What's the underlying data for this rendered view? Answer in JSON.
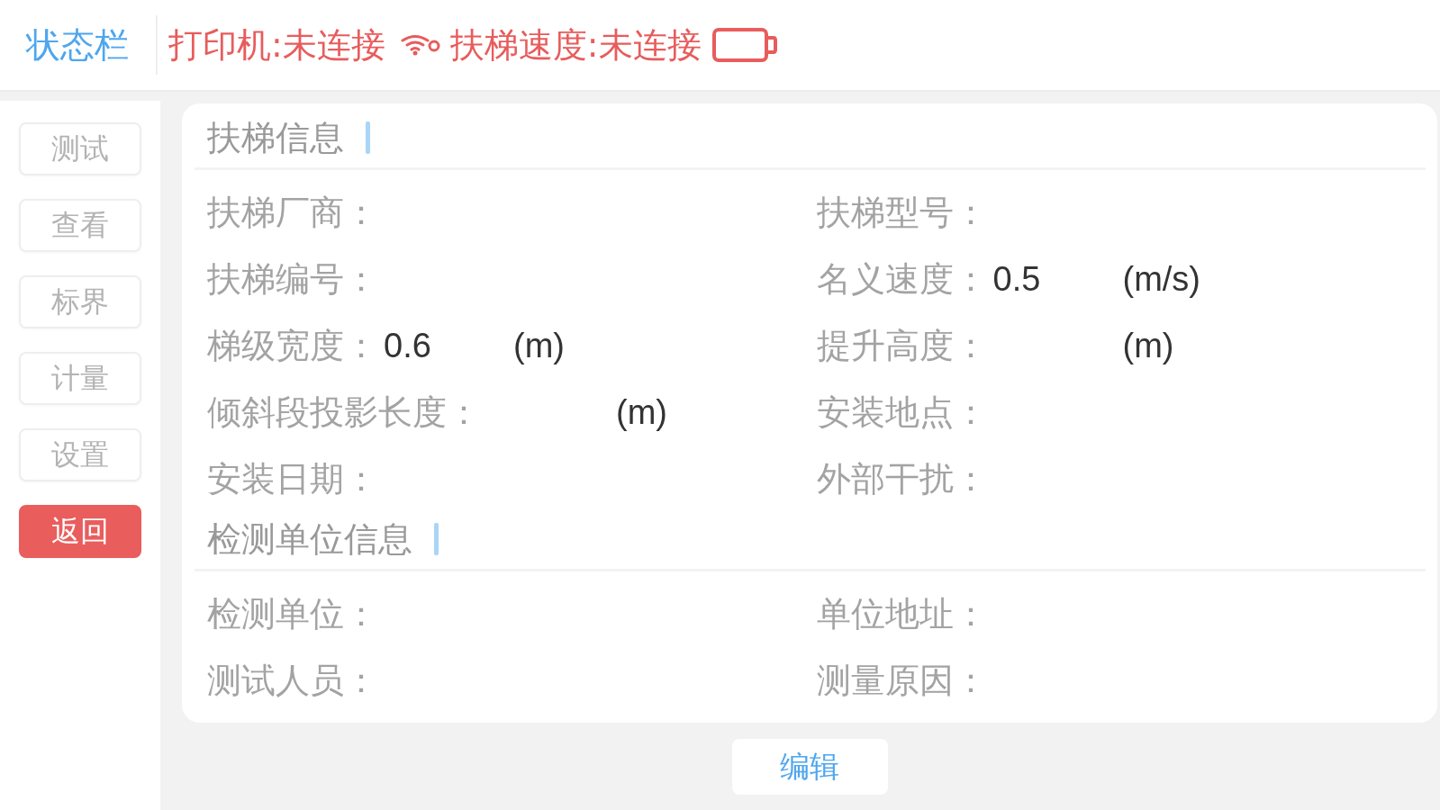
{
  "status_bar": {
    "title": "状态栏",
    "printer": {
      "text": "打印机:未连接",
      "connected": false
    },
    "speed": {
      "text": "扶梯速度:未连接",
      "connected": false
    }
  },
  "sidebar": {
    "buttons": [
      {
        "label": "测试",
        "kind": "nav"
      },
      {
        "label": "查看",
        "kind": "nav"
      },
      {
        "label": "标界",
        "kind": "nav"
      },
      {
        "label": "计量",
        "kind": "nav"
      },
      {
        "label": "设置",
        "kind": "nav"
      },
      {
        "label": "返回",
        "kind": "back"
      }
    ]
  },
  "sections": [
    {
      "title": "扶梯信息",
      "fields": [
        {
          "label": "扶梯厂商："
        },
        {
          "label": "扶梯型号："
        },
        {
          "label": "扶梯编号："
        },
        {
          "label": "名义速度：",
          "value": "0.5",
          "unit": "(m/s)"
        },
        {
          "label": "梯级宽度：",
          "value": "0.6",
          "unit": "(m)"
        },
        {
          "label": "提升高度：",
          "unit": "(m)"
        },
        {
          "label": "倾斜段投影长度：",
          "unit": "(m)"
        },
        {
          "label": "安装地点："
        },
        {
          "label": "安装日期："
        },
        {
          "label": "外部干扰："
        }
      ]
    },
    {
      "title": "检测单位信息",
      "fields": [
        {
          "label": "检测单位："
        },
        {
          "label": "单位地址："
        },
        {
          "label": "测试人员："
        },
        {
          "label": "测量原因："
        }
      ]
    }
  ],
  "edit_button": {
    "label": "编辑"
  }
}
